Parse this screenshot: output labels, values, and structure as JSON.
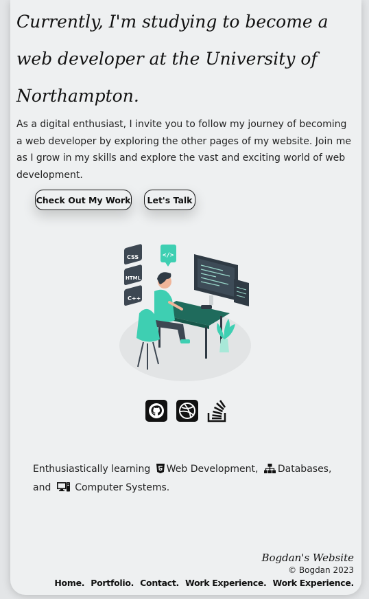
{
  "hero": {
    "heading": "Currently, I'm studying to become a web developer at the University of Northampton."
  },
  "intro": {
    "text": "As a digital enthusiast, I invite you to follow my journey of becoming a web developer by exploring the other pages of my website. Join me as I grow in my skills and explore the vast and exciting world of web development."
  },
  "buttons": {
    "work_label": "Check Out My Work",
    "talk_label": "Let's Talk"
  },
  "illustration": {
    "badges": [
      "CSS",
      "HTML",
      "C++"
    ],
    "code_bubble": "</>"
  },
  "social": [
    {
      "name": "github-icon"
    },
    {
      "name": "dribbble-icon"
    },
    {
      "name": "stackoverflow-icon"
    }
  ],
  "learning": {
    "prefix": "Enthusiastically learning",
    "item1": "Web Development,",
    "item2": "Databases, and",
    "item3": "Computer Systems."
  },
  "footer": {
    "site_name": "Bogdan's Website",
    "copyright": "© Bogdan 2023",
    "nav": [
      "Home.",
      "Portfolio.",
      "Contact.",
      "Work Experience.",
      "Work Experience."
    ]
  },
  "colors": {
    "accent": "#3ecfb2",
    "background": "#eef0f1",
    "text": "#111111"
  }
}
